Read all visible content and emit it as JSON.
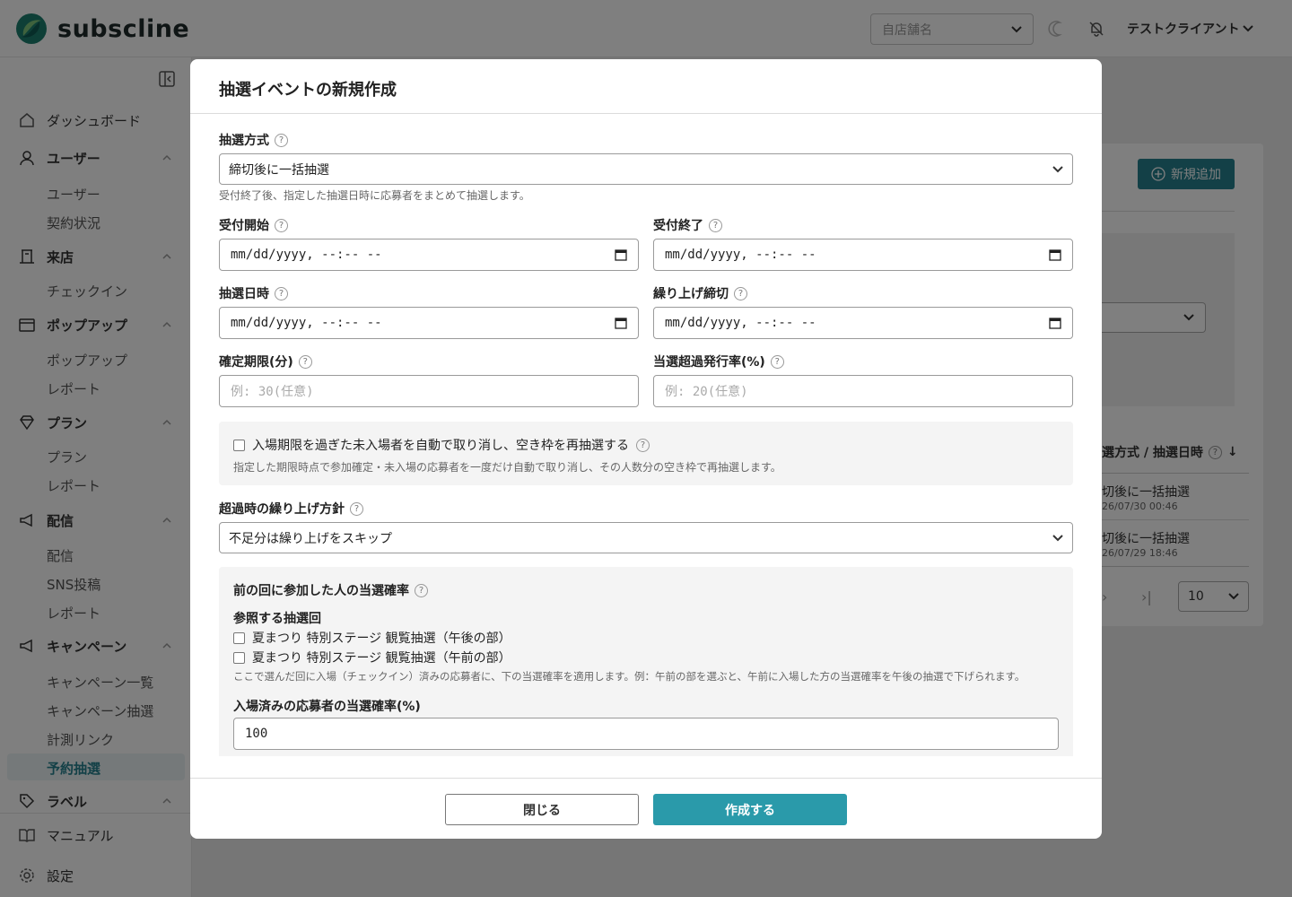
{
  "app": {
    "brand": "subscline",
    "store_select_placeholder": "自店舗名",
    "client_name": "テストクライアント"
  },
  "sidebar": {
    "groups": [
      {
        "label": "ダッシュボード",
        "items": []
      },
      {
        "label": "ユーザー",
        "items": [
          "ユーザー",
          "契約状況"
        ]
      },
      {
        "label": "来店",
        "items": [
          "チェックイン"
        ]
      },
      {
        "label": "ポップアップ",
        "items": [
          "ポップアップ",
          "レポート"
        ]
      },
      {
        "label": "プラン",
        "items": [
          "プラン",
          "レポート"
        ]
      },
      {
        "label": "配信",
        "items": [
          "配信",
          "SNS投稿",
          "レポート"
        ]
      },
      {
        "label": "キャンペーン",
        "items": [
          "キャンペーン一覧",
          "キャンペーン抽選",
          "計測リンク",
          "予約抽選"
        ]
      },
      {
        "label": "ラベル",
        "items": []
      }
    ],
    "active_item": "予約抽選",
    "bottom": {
      "manual": "マニュアル",
      "settings": "設定"
    }
  },
  "background": {
    "add_button": "新規追加",
    "column_header": "選方式 / 抽選日時",
    "rows": [
      {
        "method": "切後に一括抽選",
        "date": "26/07/30 00:46"
      },
      {
        "method": "切後に一括抽選",
        "date": "26/07/29 18:46"
      }
    ],
    "page_size": "10"
  },
  "modal": {
    "title": "抽選イベントの新規作成",
    "lottery_method": {
      "label": "抽選方式",
      "value": "締切後に一括抽選",
      "hint": "受付終了後、指定した抽選日時に応募者をまとめて抽選します。"
    },
    "accept_start": {
      "label": "受付開始",
      "value": "mm/dd/yyyy, --:-- --"
    },
    "accept_end": {
      "label": "受付終了",
      "value": "mm/dd/yyyy, --:-- --"
    },
    "draw_datetime": {
      "label": "抽選日時",
      "value": "mm/dd/yyyy, --:-- --"
    },
    "carry_deadline": {
      "label": "繰り上げ締切",
      "value": "mm/dd/yyyy, --:-- --"
    },
    "confirm_limit": {
      "label": "確定期限(分)",
      "placeholder": "例: 30(任意)"
    },
    "overissue_rate": {
      "label": "当選超過発行率(%)",
      "placeholder": "例: 20(任意)"
    },
    "auto_cancel": {
      "label": "入場期限を過ぎた未入場者を自動で取り消し、空き枠を再抽選する",
      "hint": "指定した期限時点で参加確定・未入場の応募者を一度だけ自動で取り消し、その人数分の空き枠で再抽選します。",
      "checked": false
    },
    "carry_policy": {
      "label": "超過時の繰り上げ方針",
      "value": "不足分は繰り上げをスキップ"
    },
    "previous_rate": {
      "section_label": "前の回に参加した人の当選確率",
      "ref_label": "参照する抽選回",
      "options": [
        {
          "label": "夏まつり 特別ステージ 観覧抽選（午後の部）",
          "checked": false
        },
        {
          "label": "夏まつり 特別ステージ 観覧抽選（午前の部）",
          "checked": false
        }
      ],
      "hint": "ここで選んだ回に入場（チェックイン）済みの応募者に、下の当選確率を適用します。例：午前の部を選ぶと、午前に入場した方の当選確率を午後の抽選で下げられます。",
      "rate_label": "入場済みの応募者の当選確率(%)",
      "rate_value": "100"
    },
    "buttons": {
      "close": "閉じる",
      "create": "作成する"
    }
  },
  "colors": {
    "accent": "#2a9aaa",
    "brand_teal": "#26808f",
    "overlay": "rgba(0,0,0,0.5)"
  }
}
